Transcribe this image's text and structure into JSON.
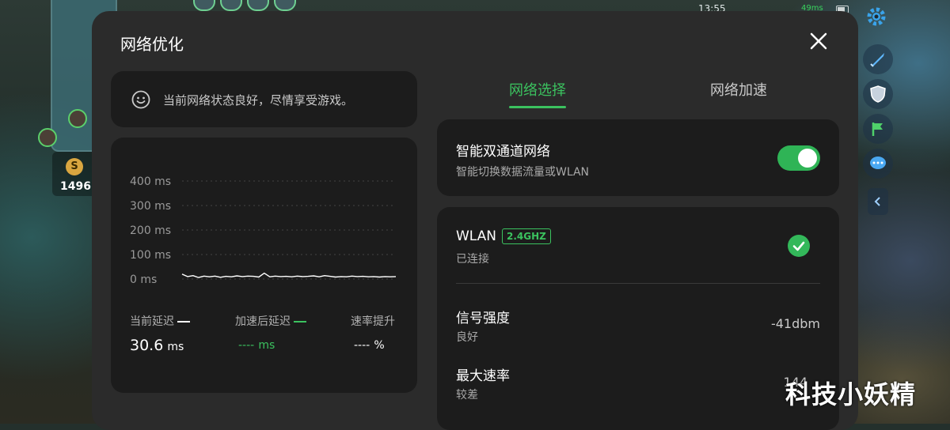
{
  "status_bar": {
    "time": "13:55",
    "network_speed": "49ms"
  },
  "hud": {
    "gold": "1496",
    "coin_letter": "S"
  },
  "watermark": "科技小妖精",
  "dialog": {
    "title": "网络优化",
    "status_message": "当前网络状态良好，尽情享受游戏。",
    "chart_data": {
      "type": "line",
      "y_tick_labels": [
        "400 ms",
        "300 ms",
        "200 ms",
        "100 ms",
        "0 ms"
      ],
      "ylim": [
        0,
        400
      ],
      "grid": true,
      "series": [
        {
          "values": [
            20,
            10,
            14,
            6,
            12,
            9,
            12,
            7,
            11,
            9,
            13,
            10,
            12,
            11,
            8,
            24,
            9,
            12,
            10,
            11,
            9,
            12,
            10,
            11,
            13,
            9,
            14,
            11,
            8,
            10,
            9,
            12,
            10,
            11,
            9,
            10,
            8,
            10,
            9,
            10
          ]
        }
      ]
    },
    "stats": [
      {
        "label": "当前延迟",
        "value": "30.6",
        "unit": "ms"
      },
      {
        "label": "加速后延迟",
        "value": "----",
        "unit": "ms"
      },
      {
        "label": "速率提升",
        "value": "----",
        "unit": "%"
      }
    ],
    "tabs": [
      {
        "label": "网络选择",
        "active": true
      },
      {
        "label": "网络加速",
        "active": false
      }
    ],
    "dual_channel": {
      "title": "智能双通道网络",
      "subtitle": "智能切换数据流量或WLAN",
      "enabled": true
    },
    "wlan": {
      "title": "WLAN",
      "band": "2.4GHZ",
      "status": "已连接",
      "signal": {
        "title": "信号强度",
        "quality": "良好",
        "value": "-41dbm"
      },
      "max_rate": {
        "title": "最大速率",
        "quality": "较差",
        "value": "144"
      }
    }
  },
  "colors": {
    "accent_green": "#3bc25f",
    "dialog_bg": "#2b2b2b",
    "card_bg": "#1c1c1c"
  }
}
